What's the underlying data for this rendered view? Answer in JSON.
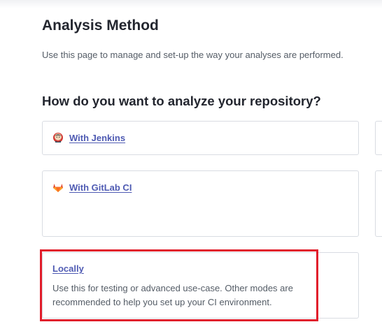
{
  "page": {
    "title": "Analysis Method",
    "description": "Use this page to manage and set-up the way your analyses are performed."
  },
  "section": {
    "heading": "How do you want to analyze your repository?"
  },
  "methods": {
    "jenkins": {
      "label": "With Jenkins",
      "icon": "jenkins-icon"
    },
    "gitlab": {
      "label": "With GitLab CI",
      "icon": "gitlab-icon"
    },
    "locally": {
      "label": "Locally",
      "description": "Use this for testing or advanced use-case. Other modes are recommended to help you set up your CI environment."
    }
  },
  "colors": {
    "link": "#4f5bb3",
    "highlight": "#e11d2b",
    "border": "#d9dce2",
    "gitlab": "#e24329"
  }
}
